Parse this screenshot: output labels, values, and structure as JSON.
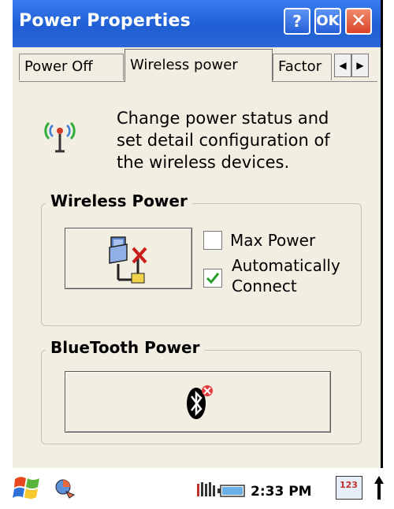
{
  "window": {
    "title": "Power Properties",
    "help_label": "?",
    "ok_label": "OK",
    "close_label": "✕"
  },
  "tabs": [
    {
      "label": "Power Off"
    },
    {
      "label": "Wireless power"
    },
    {
      "label": "Factor"
    }
  ],
  "description": "Change power status and set detail configuration of the wireless devices.",
  "wireless_group": {
    "title": "Wireless Power",
    "max_power_label": "Max Power",
    "max_power_checked": false,
    "auto_connect_label": "Automatically Connect",
    "auto_connect_checked": true
  },
  "bluetooth_group": {
    "title": "BlueTooth Power"
  },
  "taskbar": {
    "time": "2:33 PM",
    "ime_label": "123"
  },
  "colors": {
    "titlebar": "#2a66d6",
    "dialog_bg": "#f2efe2",
    "check_green": "#2a9d2a"
  }
}
